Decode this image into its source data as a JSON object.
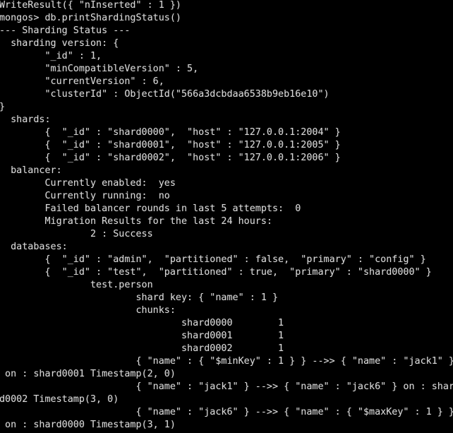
{
  "terminal": {
    "app": "mongo shell",
    "prompt": "mongos>",
    "background_color": "#000000",
    "foreground_color": "#d8d8d8",
    "columns": 78,
    "rows": 34,
    "lines": [
      "WriteResult({ \"nInserted\" : 1 })",
      "mongos> db.printShardingStatus()",
      "--- Sharding Status --- ",
      "  sharding version: {",
      "        \"_id\" : 1,",
      "        \"minCompatibleVersion\" : 5,",
      "        \"currentVersion\" : 6,",
      "        \"clusterId\" : ObjectId(\"566a3dcbdaa6538b9eb16e10\")",
      "}",
      "  shards:",
      "        {  \"_id\" : \"shard0000\",  \"host\" : \"127.0.0.1:2004\" }",
      "        {  \"_id\" : \"shard0001\",  \"host\" : \"127.0.0.1:2005\" }",
      "        {  \"_id\" : \"shard0002\",  \"host\" : \"127.0.0.1:2006\" }",
      "  balancer:",
      "        Currently enabled:  yes",
      "        Currently running:  no",
      "        Failed balancer rounds in last 5 attempts:  0",
      "        Migration Results for the last 24 hours:",
      "                2 : Success",
      "  databases:",
      "        {  \"_id\" : \"admin\",  \"partitioned\" : false,  \"primary\" : \"config\" }",
      "        {  \"_id\" : \"test\",  \"partitioned\" : true,  \"primary\" : \"shard0000\" }",
      "                test.person",
      "                        shard key: { \"name\" : 1 }",
      "                        chunks:",
      "                                shard0000        1",
      "                                shard0001        1",
      "                                shard0002        1",
      "                        { \"name\" : { \"$minKey\" : 1 } } -->> { \"name\" : \"jack1\" }",
      " on : shard0001 Timestamp(2, 0)",
      "                        { \"name\" : \"jack1\" } -->> { \"name\" : \"jack6\" } on : shar",
      "d0002 Timestamp(3, 0)",
      "                        { \"name\" : \"jack6\" } -->> { \"name\" : { \"$maxKey\" : 1 } }",
      " on : shard0000 Timestamp(3, 1)"
    ]
  }
}
